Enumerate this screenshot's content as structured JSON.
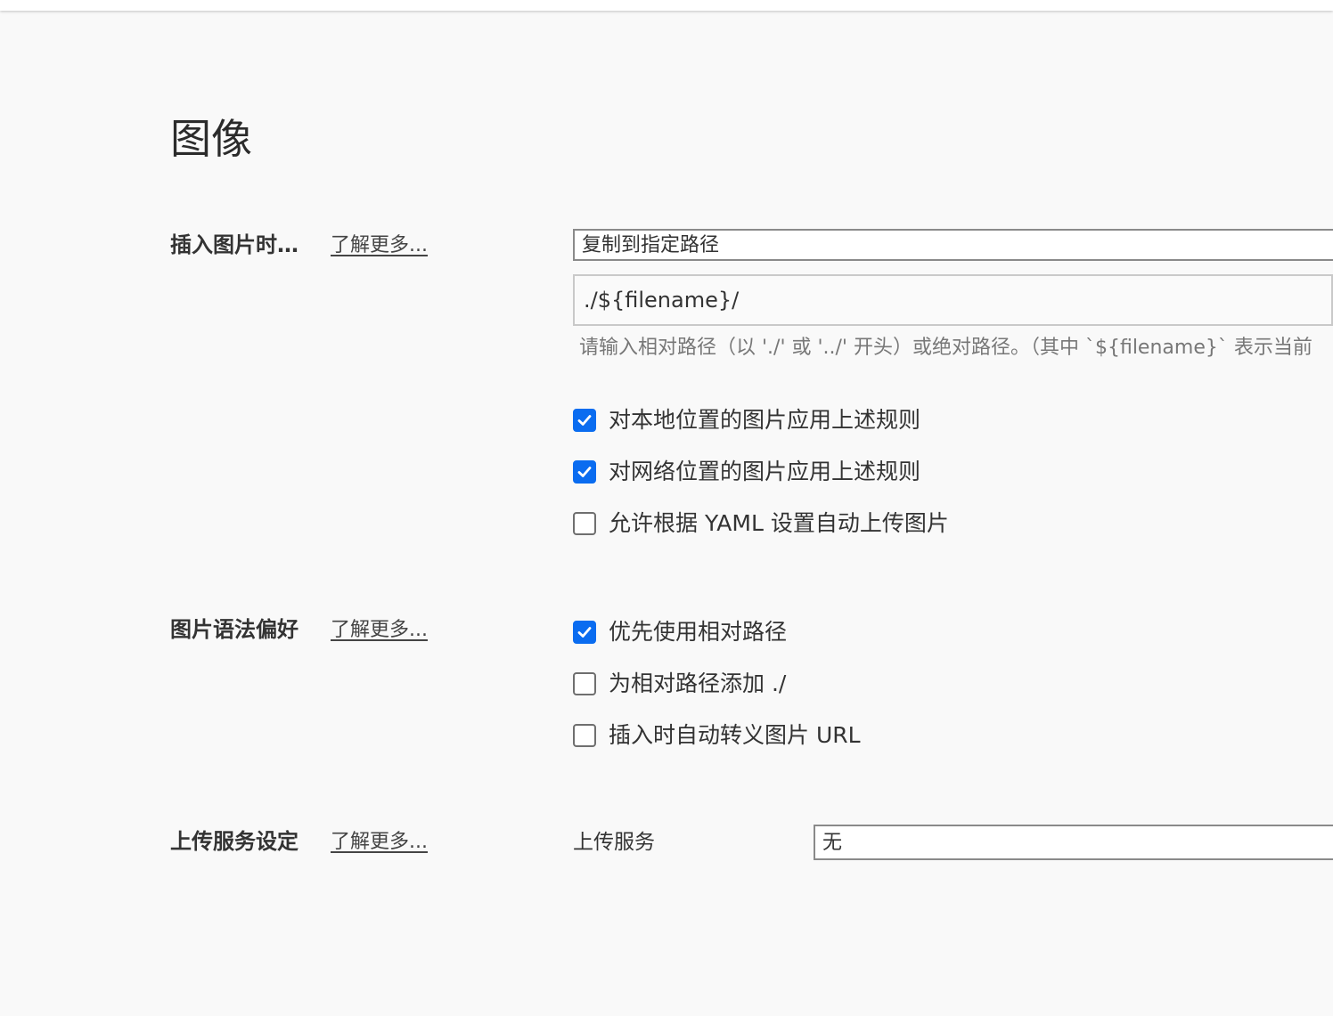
{
  "page": {
    "title": "图像"
  },
  "insert_image": {
    "label": "插入图片时…",
    "learn_more": "了解更多...",
    "action_select": "复制到指定路径",
    "path_value": "./${filename}/",
    "path_hint": "请输入相对路径（以 './' 或 '../' 开头）或绝对路径。（其中 `${filename}` 表示当前",
    "options": [
      {
        "label": "对本地位置的图片应用上述规则",
        "checked": true
      },
      {
        "label": "对网络位置的图片应用上述规则",
        "checked": true
      },
      {
        "label": "允许根据 YAML 设置自动上传图片",
        "checked": false
      }
    ]
  },
  "image_syntax": {
    "label": "图片语法偏好",
    "learn_more": "了解更多...",
    "options": [
      {
        "label": "优先使用相对路径",
        "checked": true
      },
      {
        "label": "为相对路径添加 ./",
        "checked": false
      },
      {
        "label": "插入时自动转义图片 URL",
        "checked": false
      }
    ]
  },
  "upload_service": {
    "label": "上传服务设定",
    "learn_more": "了解更多...",
    "service_label": "上传服务",
    "service_select": "无"
  },
  "colors": {
    "accent": "#0a6cf0",
    "background": "#f9f9f9"
  }
}
